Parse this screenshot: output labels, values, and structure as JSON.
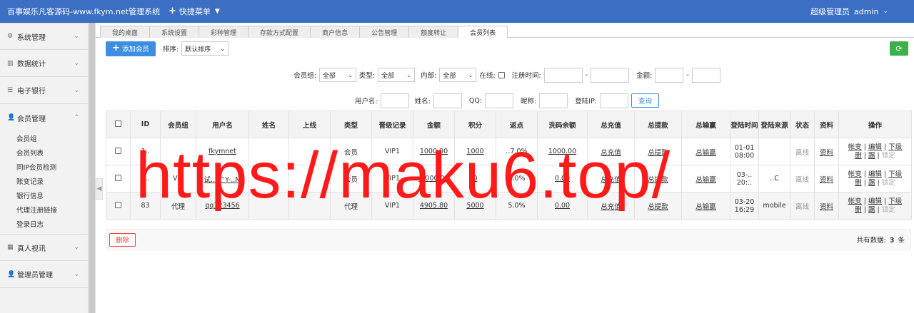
{
  "header": {
    "title": "百事娱乐凡客源码-www.fkym.net管理系统",
    "quick_menu": "快捷菜单",
    "role": "超级管理员",
    "user": "admin"
  },
  "sidebar": {
    "groups": [
      {
        "label": "系统管理",
        "icon": "gear-icon"
      },
      {
        "label": "数据统计",
        "icon": "bar-chart-icon"
      },
      {
        "label": "电子银行",
        "icon": "list-icon"
      },
      {
        "label": "会员管理",
        "icon": "user-icon",
        "expanded": true
      }
    ],
    "member_submenu": [
      "会员组",
      "会员列表",
      "同IP会员检测",
      "账变记录",
      "银行信息",
      "代理注册链接",
      "登录日志"
    ],
    "bottom_groups": [
      {
        "label": "真人视讯",
        "icon": "grid-icon"
      },
      {
        "label": "管理员管理",
        "icon": "user-icon"
      }
    ]
  },
  "tabs": [
    "我的桌面",
    "系统设置",
    "彩种管理",
    "存款方式配置",
    "商户信息",
    "公告管理",
    "额度转让",
    "会员列表"
  ],
  "toolbar": {
    "add_label": "添加会员",
    "sort_label": "排序:",
    "sort_value": "默认排序"
  },
  "filters": {
    "member_group_label": "会员组:",
    "member_group_value": "全部",
    "type_label": "类型:",
    "type_value": "全部",
    "internal_label": "内部:",
    "internal_value": "全部",
    "online_label": "在线:",
    "reg_time_label": "注册时间:",
    "dash": "-",
    "amount_label": "金额:",
    "username_label": "用户名:",
    "name_label": "姓名:",
    "qq_label": "QQ:",
    "nickname_label": "昵称:",
    "login_ip_label": "登陆IP:",
    "query_label": "查询"
  },
  "table": {
    "headers": [
      "ID",
      "会员组",
      "用户名",
      "姓名",
      "上线",
      "类型",
      "晋级记录",
      "金额",
      "积分",
      "返点",
      "洗码余额",
      "总充值",
      "总提款",
      "总输赢",
      "登陆时间",
      "登陆来源",
      "状态",
      "资料",
      "操作"
    ],
    "rows": [
      {
        "id": "1..",
        "group": "",
        "username": "fkymnet",
        "name": "",
        "upline": "",
        "type": "会员",
        "level": "VIP1",
        "amount": "1000.00",
        "points": "1000",
        "rebate": "..7.0%",
        "wash": "1000.00",
        "deposit": "总充值",
        "withdraw": "总提款",
        "winloss": "总输赢",
        "login_time": "01-01 08:00",
        "source": "",
        "status": "离线",
        "info": "资料"
      },
      {
        "id": "1..",
        "group": "VIP",
        "username": "试..$^Y-..M",
        "name": "",
        "upline": "",
        "type": "会员",
        "level": "VIP1",
        "amount": "...000.00",
        "points": "0",
        "rebate": "0.0%",
        "wash": "0.00",
        "deposit": "总充值",
        "withdraw": "总提款",
        "winloss": "总输赢",
        "login_time": "03-.. 20:..",
        "source": "..C",
        "status": "离线",
        "info": "资料"
      },
      {
        "id": "83",
        "group": "代理",
        "username": "qq123456",
        "name": "",
        "upline": "",
        "type": "代理",
        "level": "VIP1",
        "amount": "4905.80",
        "points": "5000",
        "rebate": "5.0%",
        "wash": "0.00",
        "deposit": "总充值",
        "withdraw": "总提款",
        "winloss": "总输赢",
        "login_time": "03-20 16:29",
        "source": "mobile",
        "status": "离线",
        "info": "资料"
      }
    ],
    "ops": {
      "account": "帐变",
      "edit": "编辑",
      "down": "下级",
      "delete": "删",
      "kick": "踢",
      "lock": "锁定"
    }
  },
  "footer": {
    "delete_label": "删除",
    "total_prefix": "共有数据:",
    "total_count": "3",
    "total_suffix": "条"
  },
  "watermark": "https://maku6.top/"
}
